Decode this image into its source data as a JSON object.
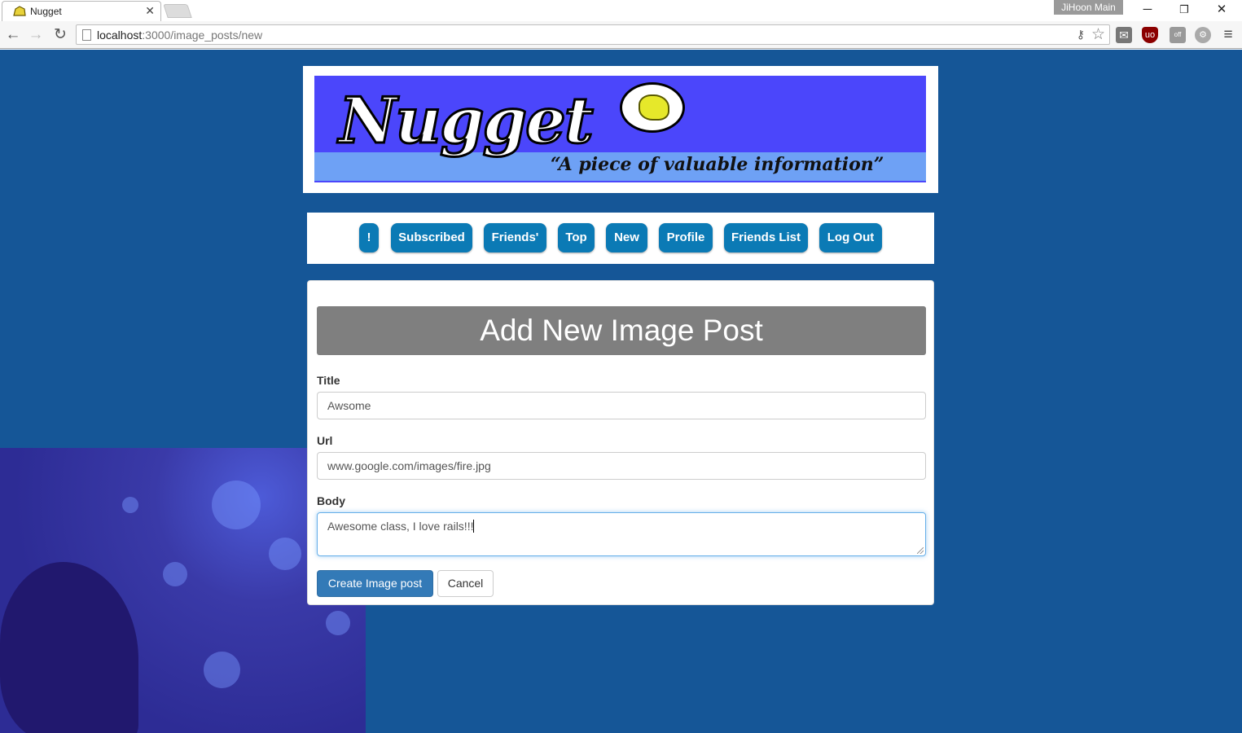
{
  "browser": {
    "tab_title": "Nugget",
    "profile_name": "JiHoon Main",
    "url_host": "localhost",
    "url_path": ":3000/image_posts/new"
  },
  "banner": {
    "logo_text": "Nugget",
    "tagline": "“A piece of valuable information”"
  },
  "nav": {
    "items": [
      "!",
      "Subscribed",
      "Friends'",
      "Top",
      "New",
      "Profile",
      "Friends List",
      "Log Out"
    ]
  },
  "form": {
    "heading": "Add New Image Post",
    "title_label": "Title",
    "title_value": "Awsome",
    "url_label": "Url",
    "url_value": "www.google.com/images/fire.jpg",
    "body_label": "Body",
    "body_value": "Awesome class, I love rails!!!",
    "submit_label": "Create Image post",
    "cancel_label": "Cancel"
  },
  "colors": {
    "page_bg": "#155697",
    "nav_button": "#0b7ab5",
    "banner_bg": "#4b46fb",
    "submit_button": "#337ab7"
  }
}
